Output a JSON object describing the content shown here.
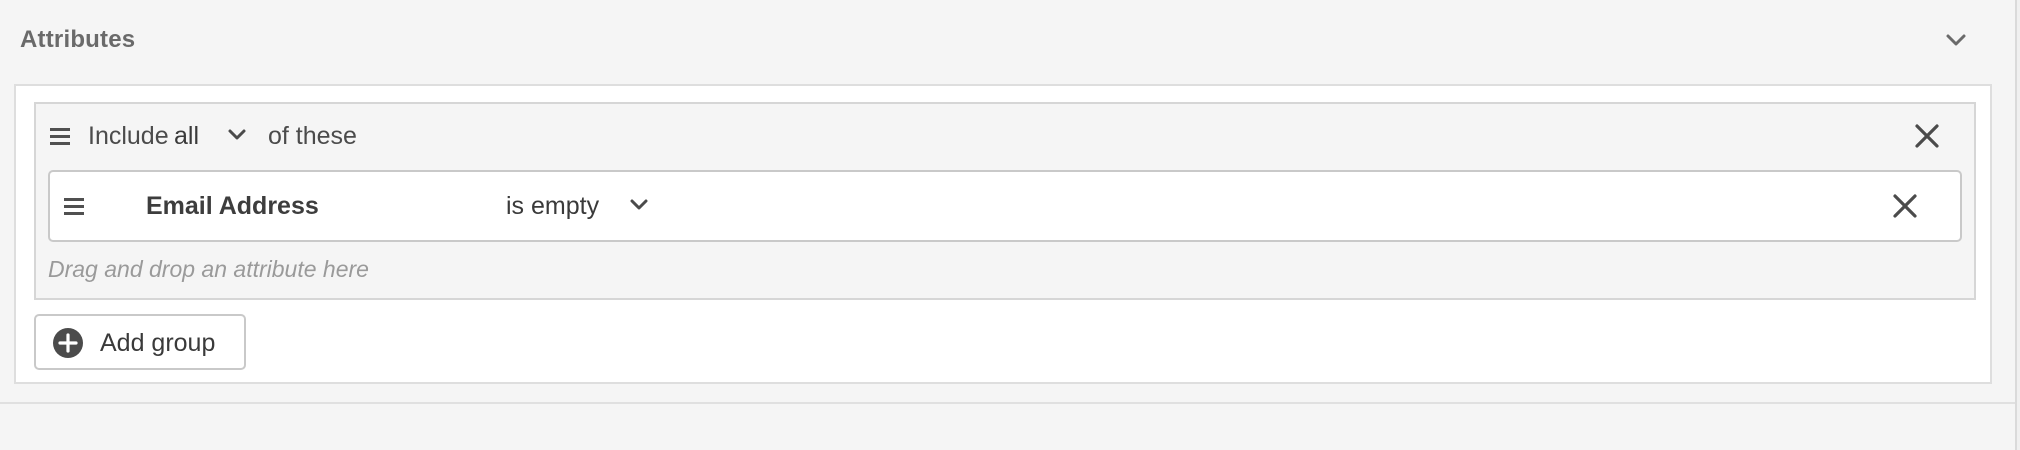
{
  "section": {
    "title": "Attributes"
  },
  "group": {
    "include_label": "Include",
    "quantifier": "all",
    "of_these_label": "of these"
  },
  "condition": {
    "attribute": "Email Address",
    "operator": "is empty"
  },
  "drop_hint": "Drag and drop an attribute here",
  "add_group": {
    "label": "Add group"
  },
  "icons": {
    "collapse": "chevron-down-icon",
    "group_handle": "drag-handle-icon",
    "quantifier_dropdown": "chevron-down-icon",
    "group_remove": "close-icon",
    "row_handle": "drag-handle-icon",
    "operator_dropdown": "chevron-down-icon",
    "row_remove": "close-icon",
    "add": "plus-circle-icon"
  },
  "colors": {
    "background": "#f5f5f5",
    "panel": "#ffffff",
    "border": "#d6d6d6",
    "text": "#4b4b4b",
    "hint": "#9a9a9a"
  }
}
